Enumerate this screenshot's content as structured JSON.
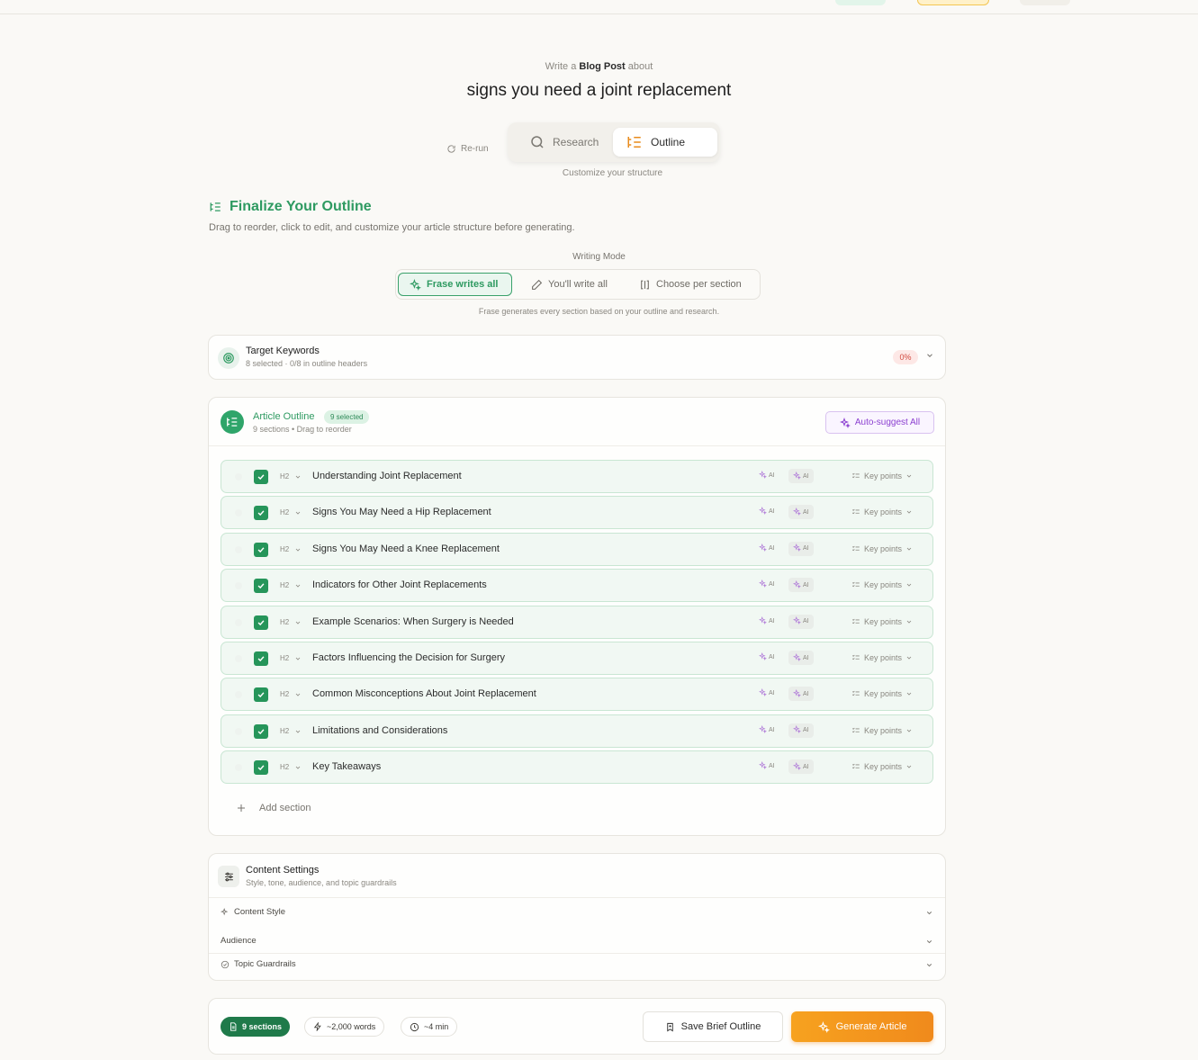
{
  "header": {
    "write_prefix": "Write a",
    "content_type": "Blog Post",
    "write_suffix": "about",
    "topic": "signs you need a joint replacement"
  },
  "steps": {
    "rerun_label": "Re-run",
    "research_label": "Research",
    "outline_label": "Outline",
    "subtitle": "Customize your structure"
  },
  "finalize": {
    "title": "Finalize Your Outline",
    "subtitle": "Drag to reorder, click to edit, and customize your article structure before generating."
  },
  "writing_mode": {
    "label": "Writing Mode",
    "options": [
      "Frase writes all",
      "You'll write all",
      "Choose per section"
    ],
    "selected": "Frase writes all",
    "description": "Frase generates every section based on your outline and research."
  },
  "keywords": {
    "title": "Target Keywords",
    "subtitle": "8 selected · 0/8 in outline headers",
    "coverage": "0%"
  },
  "outline": {
    "title": "Article Outline",
    "badge": "9 selected",
    "subtitle": "9 sections • Drag to reorder",
    "auto_suggest_label": "Auto-suggest All",
    "heading_level": "H2",
    "ai_label": "AI",
    "key_points_label": "Key points",
    "sections": [
      "Understanding Joint Replacement",
      "Signs You May Need a Hip Replacement",
      "Signs You May Need a Knee Replacement",
      "Indicators for Other Joint Replacements",
      "Example Scenarios: When Surgery is Needed",
      "Factors Influencing the Decision for Surgery",
      "Common Misconceptions About Joint Replacement",
      "Limitations and Considerations",
      "Key Takeaways"
    ],
    "add_section_label": "Add section"
  },
  "content_settings": {
    "title": "Content Settings",
    "subtitle": "Style, tone, audience, and topic guardrails",
    "items": [
      "Content Style",
      "Audience",
      "Topic Guardrails"
    ]
  },
  "footer": {
    "sections_pill": "9 sections",
    "words_pill": "~2,000 words",
    "time_pill": "~4 min",
    "save_label": "Save Brief Outline",
    "generate_label": "Generate Article"
  },
  "colors": {
    "accent_green": "#2e9a61",
    "accent_orange": "#f08a1c",
    "accent_purple": "#8b3fd0",
    "background": "#faf9f6"
  }
}
